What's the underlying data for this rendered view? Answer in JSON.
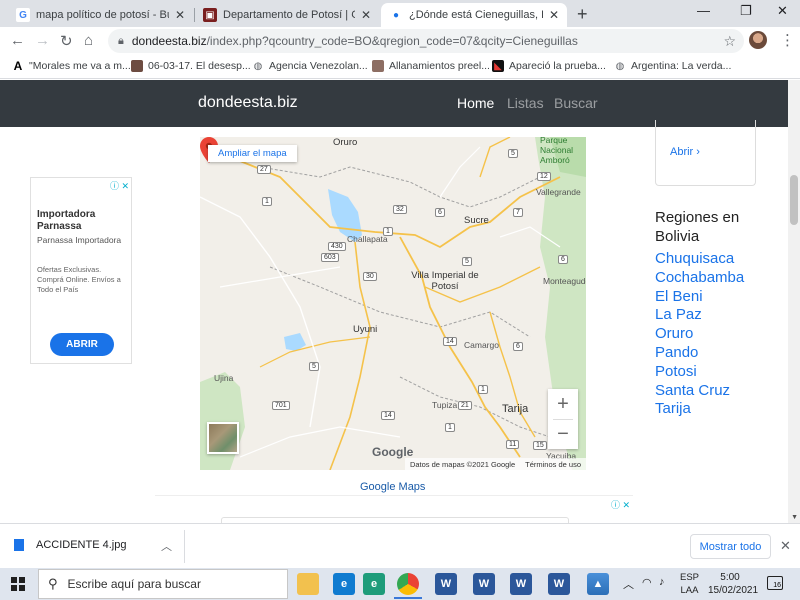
{
  "browser": {
    "tabs": [
      {
        "title": "mapa político de potosí - Búsqueda",
        "icon": "google-icon",
        "active": false
      },
      {
        "title": "Departamento de Potosí | Geogra",
        "icon": "geo-site-icon",
        "active": false
      },
      {
        "title": "¿Dónde está Cieneguillas, Potosí",
        "icon": "map-pin-icon",
        "active": true
      }
    ],
    "new_tab_label": "+",
    "address": {
      "domain": "dondeesta.biz",
      "path": "/index.php?qcountry_code=BO&qregion_code=07&qcity=Cieneguillas"
    },
    "bookmarks": [
      {
        "label": "\"Morales me va a m...",
        "icon": "amazon-a-icon"
      },
      {
        "label": "06-03-17. El desesp...",
        "icon": "photo-icon"
      },
      {
        "label": "Agencia Venezolan...",
        "icon": "globe-icon"
      },
      {
        "label": "Allanamientos preel...",
        "icon": "photo-icon"
      },
      {
        "label": "Apareció la prueba...",
        "icon": "news-icon"
      },
      {
        "label": "Argentina: La verda...",
        "icon": "globe-icon"
      }
    ]
  },
  "site": {
    "brand": "dondeesta.biz",
    "nav": [
      {
        "label": "Home",
        "active": true
      },
      {
        "label": "Listas",
        "active": false
      },
      {
        "label": "Buscar",
        "active": false
      }
    ]
  },
  "ad_left": {
    "title": "Importadora Parnassa",
    "subtitle": "Parnassa Importadora",
    "body": "Ofertas Exclusivas. Comprá Online. Envíos a Todo el País",
    "button": "ABRIR"
  },
  "map": {
    "enlarge_label": "Ampliar el mapa",
    "logo": "Google",
    "attribution": "Datos de mapas ©2021 Google",
    "terms": "Términos de uso",
    "zoom_in": "+",
    "zoom_out": "−",
    "labels": {
      "oruro": "Oruro",
      "parque": "Parque Nacional Amboró",
      "vallegrande": "Vallegrande",
      "challapata": "Challapata",
      "sucre": "Sucre",
      "villa_imperial": "Villa Imperial de Potosí",
      "monteagudo": "Monteagudo",
      "uyuni": "Uyuni",
      "camargo": "Camargo",
      "tupiza": "Tupiza",
      "tarija": "Tarija",
      "yacuiba": "Yacuiba",
      "ujina": "Ujina"
    },
    "road_numbers": [
      "27",
      "1",
      "5",
      "12",
      "430",
      "32",
      "6",
      "7",
      "603",
      "1",
      "30",
      "5",
      "6",
      "14",
      "6",
      "1",
      "5",
      "701",
      "14",
      "1",
      "21",
      "11",
      "15"
    ]
  },
  "google_maps_link": "Google Maps",
  "right_card": {
    "link": "Abrir"
  },
  "regions": {
    "title": "Regiones en Bolivia",
    "items": [
      "Chuquisaca",
      "Cochabamba",
      "El Beni",
      "La Paz",
      "Oruro",
      "Pando",
      "Potosi",
      "Santa Cruz",
      "Tarija"
    ]
  },
  "download": {
    "filename": "ACCIDENTE 4.jpg",
    "show_all": "Mostrar todo"
  },
  "taskbar": {
    "search_placeholder": "Escribe aquí para buscar",
    "lang_line1": "ESP",
    "lang_line2": "LAA",
    "time": "5:00",
    "date": "15/02/2021",
    "notifications": "16"
  }
}
